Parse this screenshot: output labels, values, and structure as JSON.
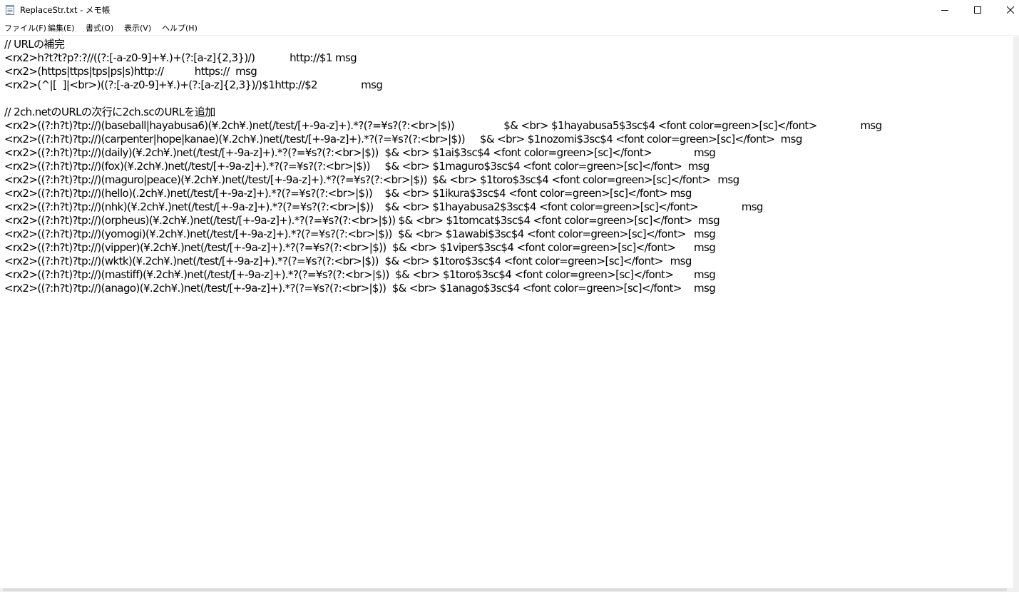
{
  "window": {
    "title": "ReplaceStr.txt - メモ帳"
  },
  "menu": {
    "items": [
      {
        "label": "ファイル(F)"
      },
      {
        "label": "編集(E)"
      },
      {
        "label": "書式(O)"
      },
      {
        "label": "表示(V)"
      },
      {
        "label": "ヘルプ(H)"
      }
    ]
  },
  "editor": {
    "lines": [
      "// URLの補完",
      "<rx2>h?t?t?p?:?//((?:[-a-z0-9]+¥.)+(?:[a-z]{2,3})/)\t\thttp://$1 msg",
      "<rx2>(https|ttps|tps|ps|s)http://\t\thttps://  msg",
      "<rx2>(^|[  ]|<br>)((?:[-a-z0-9]+¥.)+(?:[a-z]{2,3})/)$1http://$2\t\tmsg",
      "",
      "// 2ch.netのURLの次行に2ch.scのURLを追加",
      "<rx2>((?:h?t)?tp://)(baseball|hayabusa6)(¥.2ch¥.)net(/test/[+-9a-z]+).*?(?=¥s?(?:<br>|$))\t\t$& <br> $1hayabusa5$3sc$4 <font color=green>[sc]</font>\t\tmsg",
      "<rx2>((?:h?t)?tp://)(carpenter|hope|kanae)(¥.2ch¥.)net(/test/[+-9a-z]+).*?(?=¥s?(?:<br>|$))\t$& <br> $1nozomi$3sc$4 <font color=green>[sc]</font>  msg",
      "<rx2>((?:h?t)?tp://)(daily)(¥.2ch¥.)net(/test/[+-9a-z]+).*?(?=¥s?(?:<br>|$))\t$& <br> $1ai$3sc$4 <font color=green>[sc]</font>\t\tmsg",
      "<rx2>((?:h?t)?tp://)(fox)(¥.2ch¥.)net(/test/[+-9a-z]+).*?(?=¥s?(?:<br>|$))\t$& <br> $1maguro$3sc$4 <font color=green>[sc]</font>  msg",
      "<rx2>((?:h?t)?tp://)(maguro|peace)(¥.2ch¥.)net(/test/[+-9a-z]+).*?(?=¥s?(?:<br>|$))\t$& <br> $1toro$3sc$4 <font color=green>[sc]</font>\tmsg",
      "<rx2>((?:h?t)?tp://)(hello)(.2ch¥.)net(/test/[+-9a-z]+).*?(?=¥s?(?:<br>|$))\t$& <br> $1ikura$3sc$4 <font color=green>[sc]</font>\tmsg",
      "<rx2>((?:h?t)?tp://)(nhk)(¥.2ch¥.)net(/test/[+-9a-z]+).*?(?=¥s?(?:<br>|$))\t$& <br> $1hayabusa2$3sc$4 <font color=green>[sc]</font>\t\tmsg",
      "<rx2>((?:h?t)?tp://)(orpheus)(¥.2ch¥.)net(/test/[+-9a-z]+).*?(?=¥s?(?:<br>|$)) $& <br> $1tomcat$3sc$4 <font color=green>[sc]</font>  msg",
      "<rx2>((?:h?t)?tp://)(yomogi)(¥.2ch¥.)net(/test/[+-9a-z]+).*?(?=¥s?(?:<br>|$))  $& <br> $1awabi$3sc$4 <font color=green>[sc]</font>\tmsg",
      "<rx2>((?:h?t)?tp://)(vipper)(¥.2ch¥.)net(/test/[+-9a-z]+).*?(?=¥s?(?:<br>|$))  $& <br> $1viper$3sc$4 <font color=green>[sc]</font>\tmsg",
      "<rx2>((?:h?t)?tp://)(wktk)(¥.2ch¥.)net(/test/[+-9a-z]+).*?(?=¥s?(?:<br>|$))\t$& <br> $1toro$3sc$4 <font color=green>[sc]</font>\tmsg",
      "<rx2>((?:h?t)?tp://)(mastiff)(¥.2ch¥.)net(/test/[+-9a-z]+).*?(?=¥s?(?:<br>|$))  $& <br> $1toro$3sc$4 <font color=green>[sc]</font>\tmsg",
      "<rx2>((?:h?t)?tp://)(anago)(¥.2ch¥.)net(/test/[+-9a-z]+).*?(?=¥s?(?:<br>|$))  $& <br> $1anago$3sc$4 <font color=green>[sc]</font>\tmsg"
    ]
  },
  "icons": {
    "app": "notepad-icon",
    "minimize": "minimize-icon",
    "maximize": "maximize-icon",
    "close": "close-icon"
  },
  "colors": {
    "background": "#ffffff",
    "text": "#000000",
    "scrollbar": "#f0f0f0"
  }
}
